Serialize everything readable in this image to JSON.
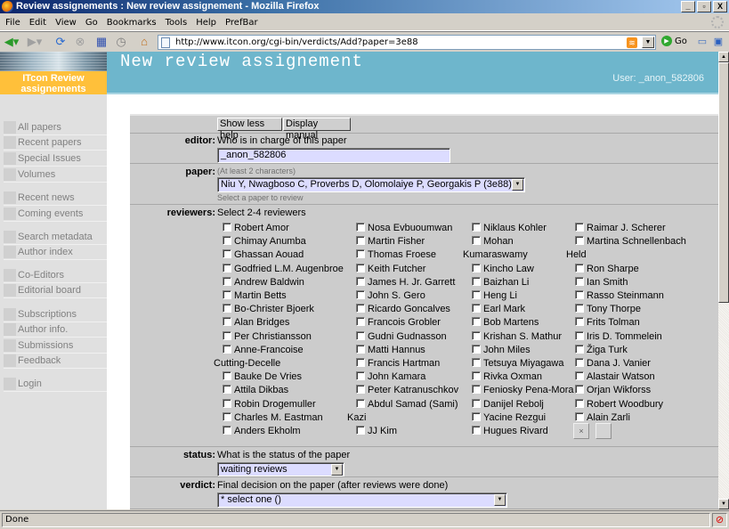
{
  "window": {
    "title": "Review assignements : New review assignement - Mozilla Firefox",
    "controls": {
      "minimize": "_",
      "maximize": "▫",
      "close": "X"
    }
  },
  "menu": [
    "File",
    "Edit",
    "View",
    "Go",
    "Bookmarks",
    "Tools",
    "Help",
    "PrefBar"
  ],
  "toolbar": {
    "url": "http://www.itcon.org/cgi-bin/verdicts/Add?paper=3e88",
    "go_label": "Go",
    "icons": [
      "back-icon",
      "forward-icon",
      "reload-icon",
      "stop-icon",
      "bookmarks-icon",
      "history-icon",
      "home-icon",
      "rss-icon",
      "go-icon",
      "new-window-icon",
      "new-tab-icon"
    ]
  },
  "banner": {
    "org_line1": "ITcon Review",
    "org_line2": "assignements",
    "page_title": "New review assignement",
    "user_label": "User: _anon_582806"
  },
  "sidebar": {
    "items": [
      {
        "label": "All papers"
      },
      {
        "label": "Recent papers"
      },
      {
        "label": "Special Issues"
      },
      {
        "label": "Volumes"
      },
      {
        "label": "Recent news"
      },
      {
        "label": "Coming events"
      },
      {
        "label": "Search metadata"
      },
      {
        "label": "Author index"
      },
      {
        "label": "Co-Editors"
      },
      {
        "label": "Editorial board"
      },
      {
        "label": "Subscriptions"
      },
      {
        "label": "Author info."
      },
      {
        "label": "Submissions"
      },
      {
        "label": "Feedback"
      },
      {
        "label": "Login"
      }
    ]
  },
  "form": {
    "buttons": {
      "show_less_help": "Show less help",
      "display_manual": "Display manual"
    },
    "editor": {
      "label": "editor:",
      "help": "Who is in charge of this paper",
      "value": "_anon_582806"
    },
    "paper": {
      "label": "paper:",
      "hint": "(At least 2 characters)",
      "value": "Niu Y, Nwagboso C, Proverbs D, Olomolaiye P, Georgakis P (3e88)",
      "help_below": "Select a paper to review"
    },
    "reviewers": {
      "label": "reviewers:",
      "help": "Select 2-4 reviewers",
      "columns": [
        [
          "Robert Amor",
          "Chimay Anumba",
          "Ghassan Aouad",
          "Godfried L.M. Augenbroe",
          "Andrew Baldwin",
          "Martin Betts",
          "Bo-Christer Bjoerk",
          "Alan Bridges",
          "Per Christiansson",
          "Anne-Francoise Cutting-Decelle",
          "Bauke De Vries",
          "Attila Dikbas",
          "Robin Drogemuller",
          "Charles M. Eastman",
          "Anders Ekholm"
        ],
        [
          "Nosa Evbuoumwan",
          "Martin Fisher",
          "Thomas Froese",
          "Keith Futcher",
          "James H. Jr. Garrett",
          "John S. Gero",
          "Ricardo Goncalves",
          "Francois Grobler",
          "Gudni Gudnasson",
          "Matti Hannus",
          "Francis Hartman",
          "John Kamara",
          "Peter Katranuschkov",
          "Abdul Samad (Sami) Kazi",
          "JJ Kim"
        ],
        [
          "Niklaus Kohler",
          "Mohan Kumaraswamy",
          "Kincho Law",
          "Baizhan Li",
          "Heng Li",
          "Earl Mark",
          "Bob Martens",
          "Krishan S. Mathur",
          "John Miles",
          "Tetsuya Miyagawa",
          "Rivka Oxman",
          "Feniosky Pena-Mora",
          "Danijel Rebolj",
          "Yacine Rezgui",
          "Hugues Rivard"
        ],
        [
          "Raimar J. Scherer",
          "Martina Schnellenbach Held",
          "Ron Sharpe",
          "Ian Smith",
          "Rasso Steinmann",
          "Tony Thorpe",
          "Frits Tolman",
          "Iris D. Tommelein",
          "Žiga Turk",
          "Dana J. Vanier",
          "Alastair Watson",
          "Orjan Wikforss",
          "Robert Woodbury",
          "Alain Zarli"
        ]
      ],
      "wrapped": {
        "0.9": [
          "Anne-Francoise",
          "Cutting-Decelle"
        ],
        "1.13": [
          "Abdul Samad (Sami)",
          "Kazi"
        ],
        "2.1": [
          "Mohan",
          "Kumaraswamy"
        ],
        "3.1": [
          "Martina Schnellenbach",
          "Held"
        ]
      },
      "clear_button": "×"
    },
    "status": {
      "label": "status:",
      "help": "What is the status of the paper",
      "value": "waiting reviews"
    },
    "verdict": {
      "label": "verdict:",
      "help": "Final decision on the paper (after reviews were done)",
      "value": "* select one ()"
    }
  },
  "statusbar": {
    "text": "Done"
  }
}
